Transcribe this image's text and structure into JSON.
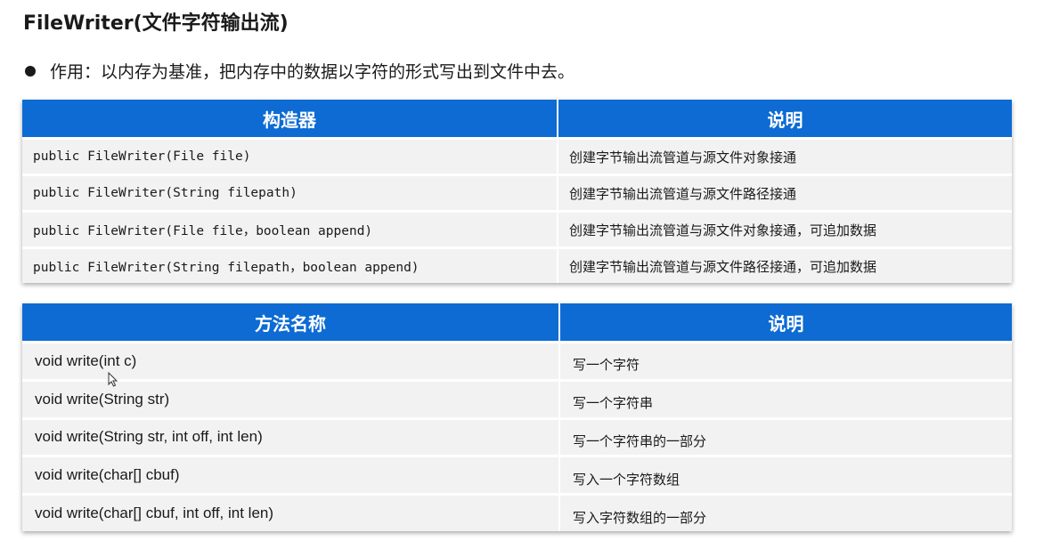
{
  "title": "FileWriter(文件字符输出流)",
  "bullet": "作用：以内存为基准，把内存中的数据以字符的形式写出到文件中去。",
  "constructors_table": {
    "headers": [
      "构造器",
      "说明"
    ],
    "rows": [
      {
        "code": "public FileWriter(File file)",
        "desc": "创建字节输出流管道与源文件对象接通"
      },
      {
        "code": "public FileWriter(String filepath)",
        "desc": "创建字节输出流管道与源文件路径接通"
      },
      {
        "code": "public FileWriter(File file，boolean append)",
        "desc": "创建字节输出流管道与源文件对象接通，可追加数据"
      },
      {
        "code": "public FileWriter(String filepath，boolean append)",
        "desc": "创建字节输出流管道与源文件路径接通，可追加数据"
      }
    ]
  },
  "methods_table": {
    "headers": [
      "方法名称",
      "说明"
    ],
    "rows": [
      {
        "code": "void write(int c)",
        "desc": "写一个字符"
      },
      {
        "code": "void write(String str)",
        "desc": "写一个字符串"
      },
      {
        "code": "void write(String str, int off, int len)",
        "desc": "写一个字符串的一部分"
      },
      {
        "code": "void write(char[] cbuf)",
        "desc": "写入一个字符数组"
      },
      {
        "code": "void write(char[] cbuf, int off, int len)",
        "desc": "写入字符数组的一部分"
      }
    ]
  },
  "colors": {
    "header_bg": "#0d6bd3",
    "row_bg": "#f2f2f2"
  }
}
